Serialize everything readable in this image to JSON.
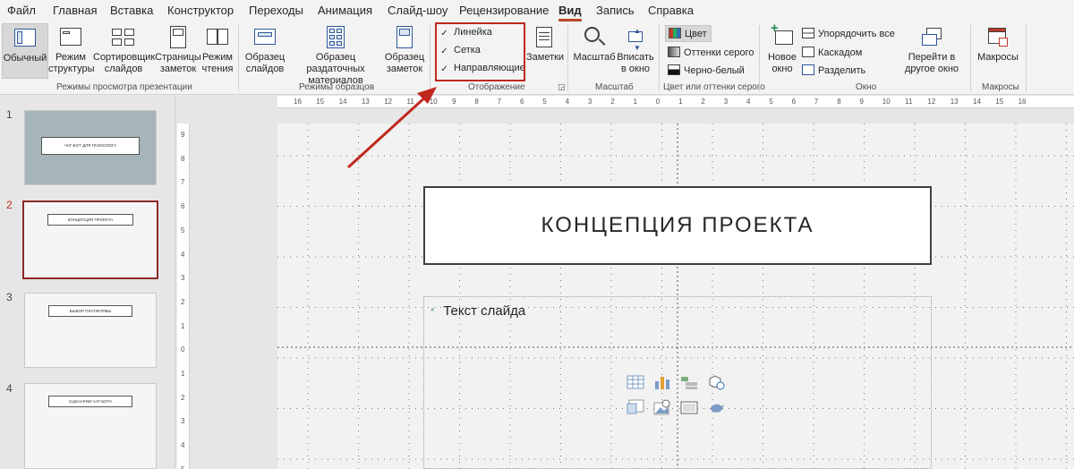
{
  "menu": {
    "tabs": [
      {
        "label": "Файл"
      },
      {
        "label": "Главная"
      },
      {
        "label": "Вставка"
      },
      {
        "label": "Конструктор"
      },
      {
        "label": "Переходы"
      },
      {
        "label": "Анимация"
      },
      {
        "label": "Слайд-шоу"
      },
      {
        "label": "Рецензирование"
      },
      {
        "label": "Вид",
        "active": true
      },
      {
        "label": "Запись"
      },
      {
        "label": "Справка"
      }
    ]
  },
  "ribbon": {
    "views": {
      "normal": "Обычный",
      "outline_1": "Режим",
      "outline_2": "структуры",
      "sorter_1": "Сортировщик",
      "sorter_2": "слайдов",
      "notes_page_1": "Страницы",
      "notes_page_2": "заметок",
      "reading_1": "Режим",
      "reading_2": "чтения",
      "group_label": "Режимы просмотра презентации"
    },
    "masters": {
      "slide_master_1": "Образец",
      "slide_master_2": "слайдов",
      "handout_master_1": "Образец раздаточных",
      "handout_master_2": "материалов",
      "notes_master_1": "Образец",
      "notes_master_2": "заметок",
      "group_label": "Режимы образцов"
    },
    "show": {
      "ruler": "Линейка",
      "grid": "Сетка",
      "guides": "Направляющие",
      "notes": "Заметки",
      "group_label": "Отображение",
      "check_mark": "✓"
    },
    "zoom": {
      "zoom": "Масштаб",
      "fit_1": "Вписать",
      "fit_2": "в окно",
      "group_label": "Масштаб"
    },
    "color": {
      "color": "Цвет",
      "grayscale": "Оттенки серого",
      "bw": "Черно-белый",
      "group_label": "Цвет или оттенки серого"
    },
    "window": {
      "new_1": "Новое",
      "new_2": "окно",
      "arrange_all": "Упорядочить все",
      "cascade": "Каскадом",
      "split": "Разделить",
      "switch_1": "Перейти в",
      "switch_2": "другое окно",
      "group_label": "Окно"
    },
    "macros": {
      "macros": "Макросы",
      "group_label": "Макросы"
    }
  },
  "thumbnails": [
    {
      "number": "1",
      "title": "ЧАТ-БОТ ДЛЯ ПСИХОЛОГА"
    },
    {
      "number": "2",
      "title": "КОНЦЕПЦИЯ ПРОЕКТА"
    },
    {
      "number": "3",
      "title": "ВЫБОР ПЛАТФОРМЫ"
    },
    {
      "number": "4",
      "title": "СЦЕНАРИИ ЧАТ-БОТА"
    }
  ],
  "ruler": {
    "h_ticks": [
      "16",
      "15",
      "14",
      "13",
      "12",
      "11",
      "10",
      "9",
      "8",
      "7",
      "6",
      "5",
      "4",
      "3",
      "2",
      "1",
      "0",
      "1",
      "2",
      "3",
      "4",
      "5",
      "6",
      "7",
      "8",
      "9",
      "10",
      "11",
      "12",
      "13",
      "14",
      "15",
      "16"
    ],
    "v_ticks": [
      "9",
      "8",
      "7",
      "6",
      "5",
      "4",
      "3",
      "2",
      "1",
      "0",
      "1",
      "2",
      "3",
      "4",
      "5"
    ]
  },
  "slide": {
    "title": "КОНЦЕПЦИЯ ПРОЕКТА",
    "bullet": "Текст слайда"
  },
  "colors": {
    "accent": "#b7472a",
    "highlight": "#c0281e",
    "thumb1_bg": "#a5b5b9"
  }
}
